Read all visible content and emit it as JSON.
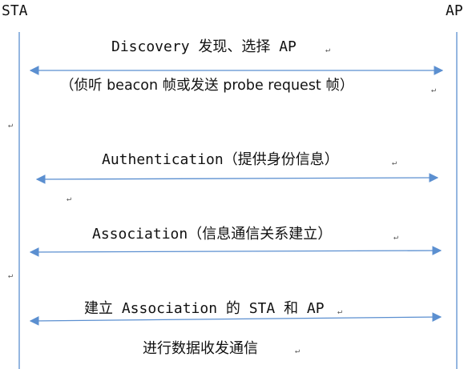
{
  "actors": {
    "left": "STA",
    "right": "AP"
  },
  "messages": [
    {
      "label": "Discovery 发现、选择 AP",
      "note": "（侦听 beacon 帧或发送 probe request 帧）"
    },
    {
      "label": "Authentication（提供身份信息）",
      "note": ""
    },
    {
      "label": "Association（信息通信关系建立）",
      "note": ""
    },
    {
      "label": "建立 Association 的 STA 和 AP",
      "note": "进行数据收发通信"
    }
  ],
  "paragraph_mark": "↵",
  "colors": {
    "line": "#5b8fd0",
    "text": "#111111",
    "mark": "#555555"
  }
}
